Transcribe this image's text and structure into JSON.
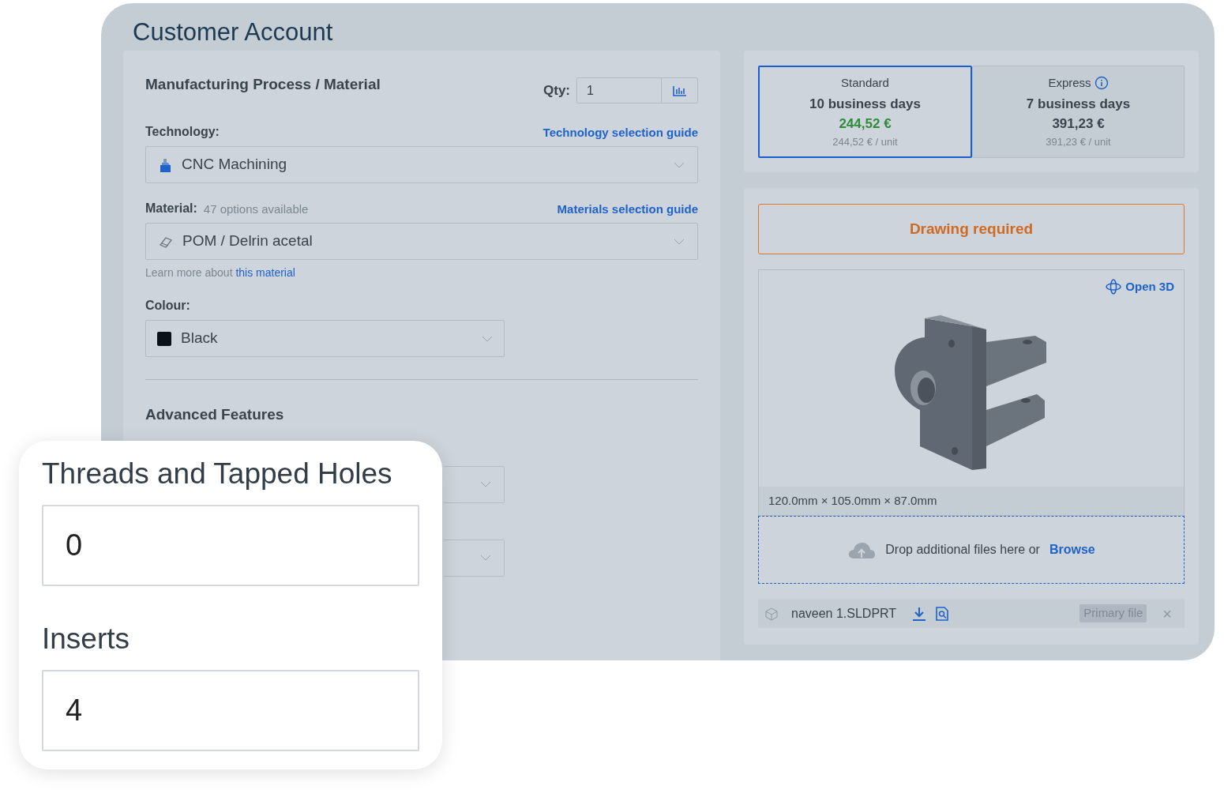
{
  "page": {
    "title": "Customer Account"
  },
  "process": {
    "title": "Manufacturing Process / Material",
    "qty_label": "Qty:",
    "qty_value": "1",
    "technology": {
      "label": "Technology:",
      "guide": "Technology selection guide",
      "value": "CNC Machining"
    },
    "material": {
      "label": "Material:",
      "count": "47 options available",
      "guide": "Materials selection guide",
      "value": "POM / Delrin acetal",
      "note": "Learn more about",
      "note_link": "this material"
    },
    "colour": {
      "label": "Colour:",
      "value": "Black",
      "color": "#0b1118"
    },
    "advanced_title": "Advanced Features"
  },
  "lead_times": [
    {
      "name": "Standard",
      "days": "10 business days",
      "price": "244,52 €",
      "unit_price": "244,52 € / unit",
      "info": false,
      "selected": true
    },
    {
      "name": "Express",
      "days": "7 business days",
      "price": "391,23 €",
      "unit_price": "391,23 € / unit",
      "info": true,
      "selected": false
    }
  ],
  "files": {
    "warning": "Drawing required",
    "open_3d": "Open 3D",
    "dimensions": "120.0mm × 105.0mm × 87.0mm",
    "drop_text": "Drop additional files here or",
    "browse": "Browse",
    "file": {
      "name": "naveen 1.SLDPRT",
      "badge": "Primary file",
      "close": "×"
    }
  },
  "overlay": {
    "fields": [
      {
        "label": "Threads and Tapped Holes",
        "value": "0"
      },
      {
        "label": "Inserts",
        "value": "4"
      }
    ]
  }
}
